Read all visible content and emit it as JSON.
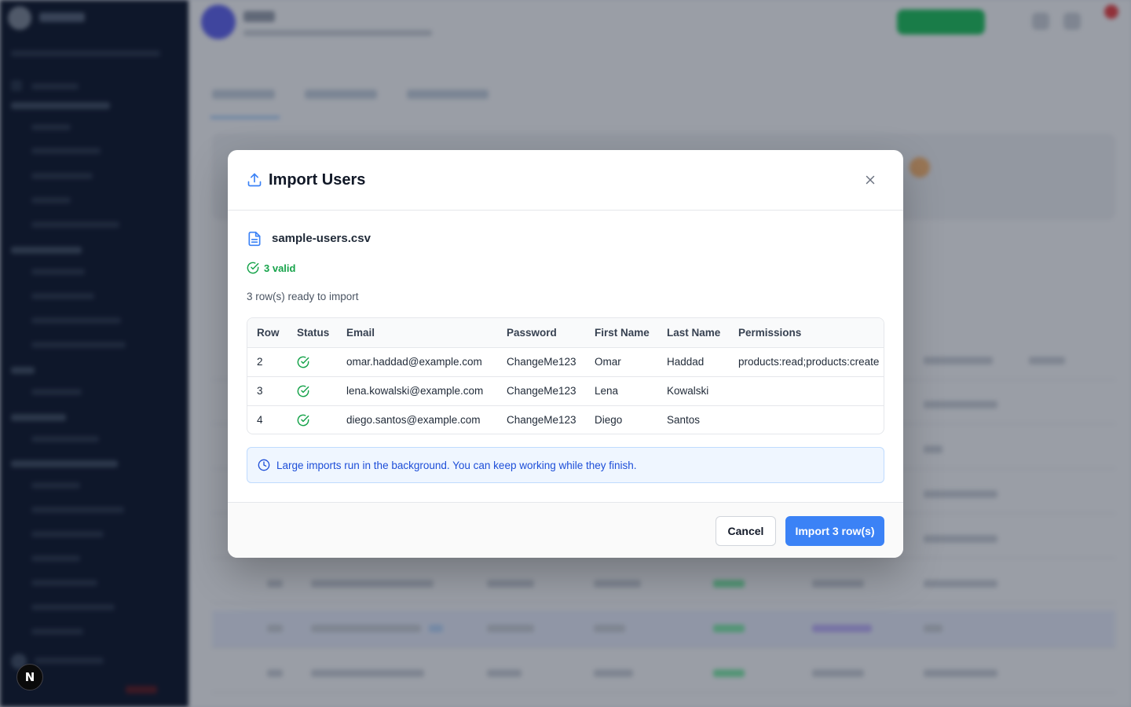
{
  "modal": {
    "title": "Import Users",
    "file_name": "sample-users.csv",
    "valid_label": "3 valid",
    "ready_text": "3 row(s) ready to import",
    "notice": "Large imports run in the background. You can keep working while they finish.",
    "cancel_label": "Cancel",
    "import_label": "Import 3 row(s)"
  },
  "table": {
    "columns": [
      "Row",
      "Status",
      "Email",
      "Password",
      "First Name",
      "Last Name",
      "Permissions"
    ],
    "rows": [
      {
        "row": "2",
        "status": "valid",
        "email": "omar.haddad@example.com",
        "password": "ChangeMe123",
        "first_name": "Omar",
        "last_name": "Haddad",
        "permissions": "products:read;products:create"
      },
      {
        "row": "3",
        "status": "valid",
        "email": "lena.kowalski@example.com",
        "password": "ChangeMe123",
        "first_name": "Lena",
        "last_name": "Kowalski",
        "permissions": ""
      },
      {
        "row": "4",
        "status": "valid",
        "email": "diego.santos@example.com",
        "password": "ChangeMe123",
        "first_name": "Diego",
        "last_name": "Santos",
        "permissions": ""
      }
    ]
  },
  "badge": {
    "label": "N"
  },
  "icons": {
    "title": "upload-icon",
    "close": "close-icon",
    "file": "file-text-icon",
    "valid": "check-circle-icon",
    "notice": "clock-icon"
  },
  "colors": {
    "primary": "#3b82f6",
    "success": "#16a34a",
    "info_text": "#1d4ed8",
    "info_bg": "#eff6ff",
    "sidebar": "#0f172a"
  }
}
